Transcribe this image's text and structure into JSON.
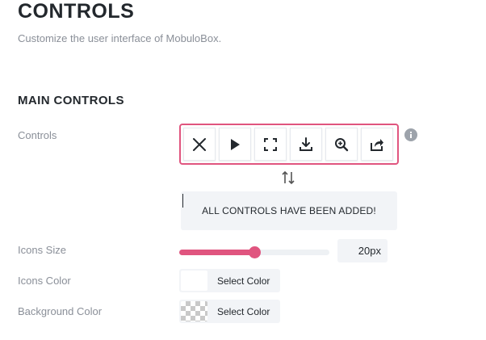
{
  "header": {
    "title": "CONTROLS",
    "description": "Customize the user interface of MobuloBox."
  },
  "section": {
    "title": "MAIN CONTROLS"
  },
  "controls": {
    "label": "Controls",
    "buttons": [
      {
        "name": "close",
        "icon": "close-icon"
      },
      {
        "name": "play",
        "icon": "play-icon"
      },
      {
        "name": "fullscreen",
        "icon": "fullscreen-icon"
      },
      {
        "name": "download",
        "icon": "download-icon"
      },
      {
        "name": "zoom",
        "icon": "zoom-in-icon"
      },
      {
        "name": "share",
        "icon": "share-icon"
      }
    ],
    "drop_message": "ALL CONTROLS HAVE BEEN ADDED!",
    "accent_color": "#e0557f"
  },
  "icons_size": {
    "label": "Icons Size",
    "value": "20px",
    "slider_fraction": 0.5
  },
  "icons_color": {
    "label": "Icons Color",
    "button_label": "Select Color",
    "color": "#ffffff"
  },
  "background_color": {
    "label": "Background Color",
    "button_label": "Select Color",
    "color": "transparent"
  }
}
